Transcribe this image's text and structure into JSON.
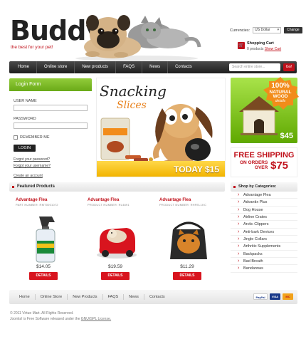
{
  "header": {
    "logo": "Buddy",
    "tagline": "the best for your pet!",
    "currency_label": "Currencies:",
    "currency_value": "US Dollar",
    "currency_button": "Change",
    "cart_title": "Shopping Cart",
    "cart_count": "0 products",
    "cart_link": "Show Cart"
  },
  "nav": {
    "items": [
      "Home",
      "Online store",
      "New products",
      "FAQS",
      "News",
      "Contacts"
    ],
    "search_placeholder": "Search entire store...",
    "search_button": "Go!"
  },
  "login": {
    "title": "Login Form",
    "username_label": "USER NAME",
    "password_label": "PASSWORD",
    "remember_label": "REMEMBER ME",
    "login_button": "LOGIN",
    "forgot_password": "Forgot your password?",
    "forgot_username": "Forgot your username?",
    "create_account": "Create an account"
  },
  "banner": {
    "line1": "Snacking",
    "line2": "Slices",
    "offer": "TODAY $15"
  },
  "promo_house": {
    "badge_pct": "100%",
    "badge_l1": "NATURAL",
    "badge_l2": "WOOD",
    "badge_l3": "details",
    "price": "$45"
  },
  "promo_shipping": {
    "title": "FREE SHIPPING",
    "on_orders": "ON ORDERS",
    "over": "OVER",
    "amount": "$75"
  },
  "featured": {
    "title": "Featured Products",
    "details_label": "DETAILS",
    "products": [
      {
        "name": "Advantage Flea",
        "part": "PART NUMBER: RMT0001072",
        "price": "$14.05"
      },
      {
        "name": "Advantage Flea",
        "part": "PRODUCT NUMBER: RL4891",
        "price": "$19.59"
      },
      {
        "name": "Advantage Flea",
        "part": "PRODUCT NUMBER: RHFEL1KC",
        "price": "$11.29"
      }
    ]
  },
  "categories": {
    "title": "Shop by Categories:",
    "items": [
      "Advantage Flea",
      "Advantix Plus",
      "Dog House",
      "Airline Crates",
      "Arctic Clippers",
      "Anti-bark Devices",
      "Jingle Collars",
      "Arthritic Supplements",
      "Backpacks",
      "Bad Breath",
      "Bandannas"
    ]
  },
  "footer": {
    "items": [
      "Home",
      "Online Store",
      "New Products",
      "FAQS",
      "News",
      "Contacts"
    ],
    "payments": [
      "PayPal",
      "VISA",
      "MC"
    ],
    "copyright": "© 2011 Virtue Mart. All Rights Reserved.",
    "license_text": "Joomla! is Free Software released under the",
    "license_link": "GNU/GPL License."
  },
  "colors": {
    "accent": "#c0101a",
    "green": "#6aaa18",
    "orange": "#f28c1a",
    "nav_dark": "#2a2a2a"
  }
}
